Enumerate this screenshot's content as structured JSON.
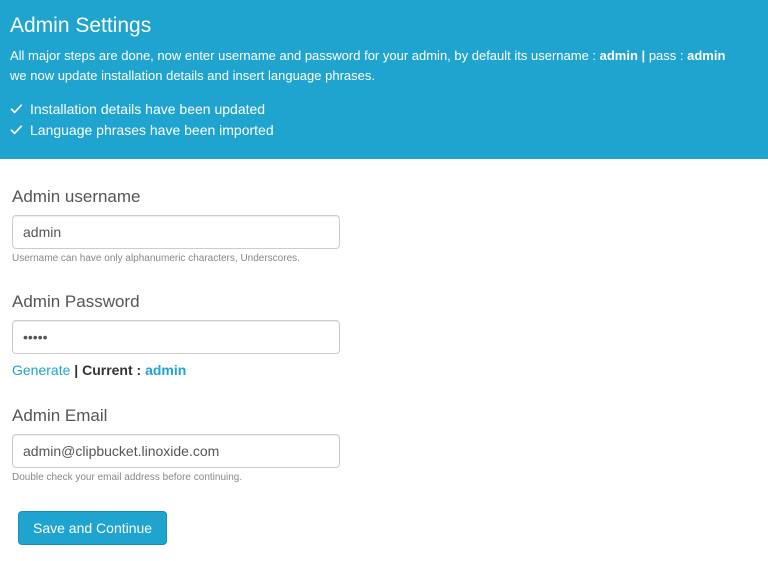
{
  "header": {
    "title": "Admin Settings",
    "desc_pre": "All major steps are done, now enter username and password for your admin, by default its username : ",
    "desc_user": "admin",
    "desc_sep": " | ",
    "desc_pass_label": "pass : ",
    "desc_pass": "admin",
    "desc_line2": "we now update installation details and insert language phrases.",
    "status1": "Installation details have been updated",
    "status2": "Language phrases have been imported"
  },
  "form": {
    "username": {
      "label": "Admin username",
      "value": "admin",
      "help": "Username can have only alphanumeric characters, Underscores."
    },
    "password": {
      "label": "Admin Password",
      "value": "•••••",
      "generate": "Generate",
      "sep": " | ",
      "current_label": "Current : ",
      "current_value": "admin"
    },
    "email": {
      "label": "Admin Email",
      "value": "admin@clipbucket.linoxide.com",
      "help": "Double check your email address before continuing."
    },
    "submit": "Save and Continue"
  }
}
